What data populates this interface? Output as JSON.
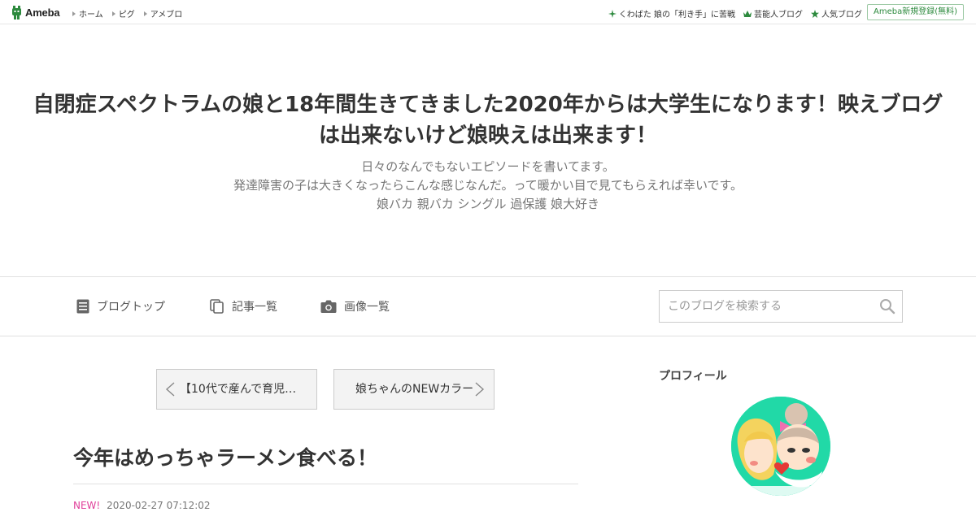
{
  "topbar": {
    "brand": "Ameba",
    "nav": [
      "ホーム",
      "ピグ",
      "アメブロ"
    ],
    "right_links": [
      {
        "icon": "sparkle-icon",
        "label": "くわばた 娘の「利き手」に苦戦"
      },
      {
        "icon": "crown-icon",
        "label": "芸能人ブログ"
      },
      {
        "icon": "star-icon",
        "label": "人気ブログ"
      }
    ],
    "register_label": "Ameba新規登録(無料)"
  },
  "blog": {
    "title": "自閉症スペクトラムの娘と18年間生きてきました2020年からは大学生になります！映えブログは出来ないけど娘映えは出来ます！",
    "description": [
      "日々のなんでもないエピソードを書いてます。",
      "発達障害の子は大きくなったらこんな感じなんだ。って暖かい目で見てもらえれば幸いです。",
      "娘バカ 親バカ シングル 過保護 娘大好き"
    ]
  },
  "nav": {
    "blog_top": "ブログトップ",
    "article_list": "記事一覧",
    "image_list": "画像一覧",
    "search_placeholder": "このブログを検索する"
  },
  "pager": {
    "prev": "【10代で産んで育児…",
    "next": "娘ちゃんのNEWカラー"
  },
  "entry": {
    "title": "今年はめっちゃラーメン食べる！",
    "badge": "NEW!",
    "date": "2020-02-27 07:12:02"
  },
  "sidebar": {
    "profile_title": "プロフィール"
  },
  "colors": {
    "brand_green": "#2d8a3e",
    "avatar_bg": "#21d9a7",
    "new_badge": "#e0409a"
  }
}
